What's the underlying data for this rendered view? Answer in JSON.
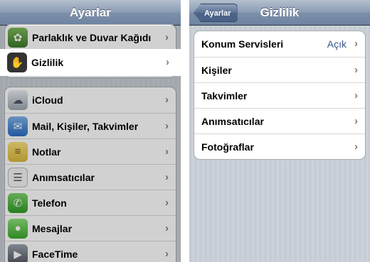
{
  "left": {
    "title": "Ayarlar",
    "group1": [
      {
        "label": "Parlaklık ve Duvar Kağıdı",
        "icon": "flower-icon"
      },
      {
        "label": "Gizlilik",
        "icon": "hand-icon"
      }
    ],
    "group2": [
      {
        "label": "iCloud",
        "icon": "cloud-icon"
      },
      {
        "label": "Mail, Kişiler, Takvimler",
        "icon": "mail-icon"
      },
      {
        "label": "Notlar",
        "icon": "notes-icon"
      },
      {
        "label": "Anımsatıcılar",
        "icon": "reminders-icon"
      },
      {
        "label": "Telefon",
        "icon": "phone-icon"
      },
      {
        "label": "Mesajlar",
        "icon": "messages-icon"
      },
      {
        "label": "FaceTime",
        "icon": "facetime-icon"
      }
    ]
  },
  "right": {
    "back_label": "Ayarlar",
    "title": "Gizlilik",
    "items": [
      {
        "label": "Konum Servisleri",
        "value": "Açık"
      },
      {
        "label": "Kişiler"
      },
      {
        "label": "Takvimler"
      },
      {
        "label": "Anımsatıcılar"
      },
      {
        "label": "Fotoğraflar"
      }
    ]
  },
  "colors": {
    "nav_bar": "#7d90aa",
    "value_text": "#385487",
    "background": "#c5ccd4"
  }
}
